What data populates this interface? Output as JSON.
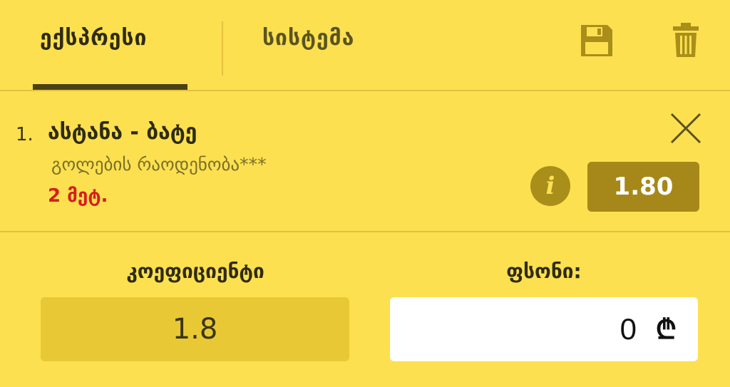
{
  "tabs": {
    "express": "ექსპრესი",
    "system": "სისტემა"
  },
  "icons": {
    "save": "save-icon",
    "trash": "trash-icon",
    "close": "close-icon",
    "info": "info-icon"
  },
  "bet": {
    "number": "1.",
    "title": "ასტანა - ბატე",
    "market": "გოლების რაოდენობა***",
    "time": "2 მეტ.",
    "info_label": "i",
    "odds": "1.80"
  },
  "summary": {
    "coef_label": "კოეფიციენტი",
    "coef_value": "1.8",
    "stake_label": "ფსონი:",
    "stake_value": "0",
    "currency": "₾"
  },
  "colors": {
    "background": "#fce050",
    "accent_dark": "#4a4215",
    "odds_bg": "#a6881a",
    "time_red": "#d61e1e"
  }
}
